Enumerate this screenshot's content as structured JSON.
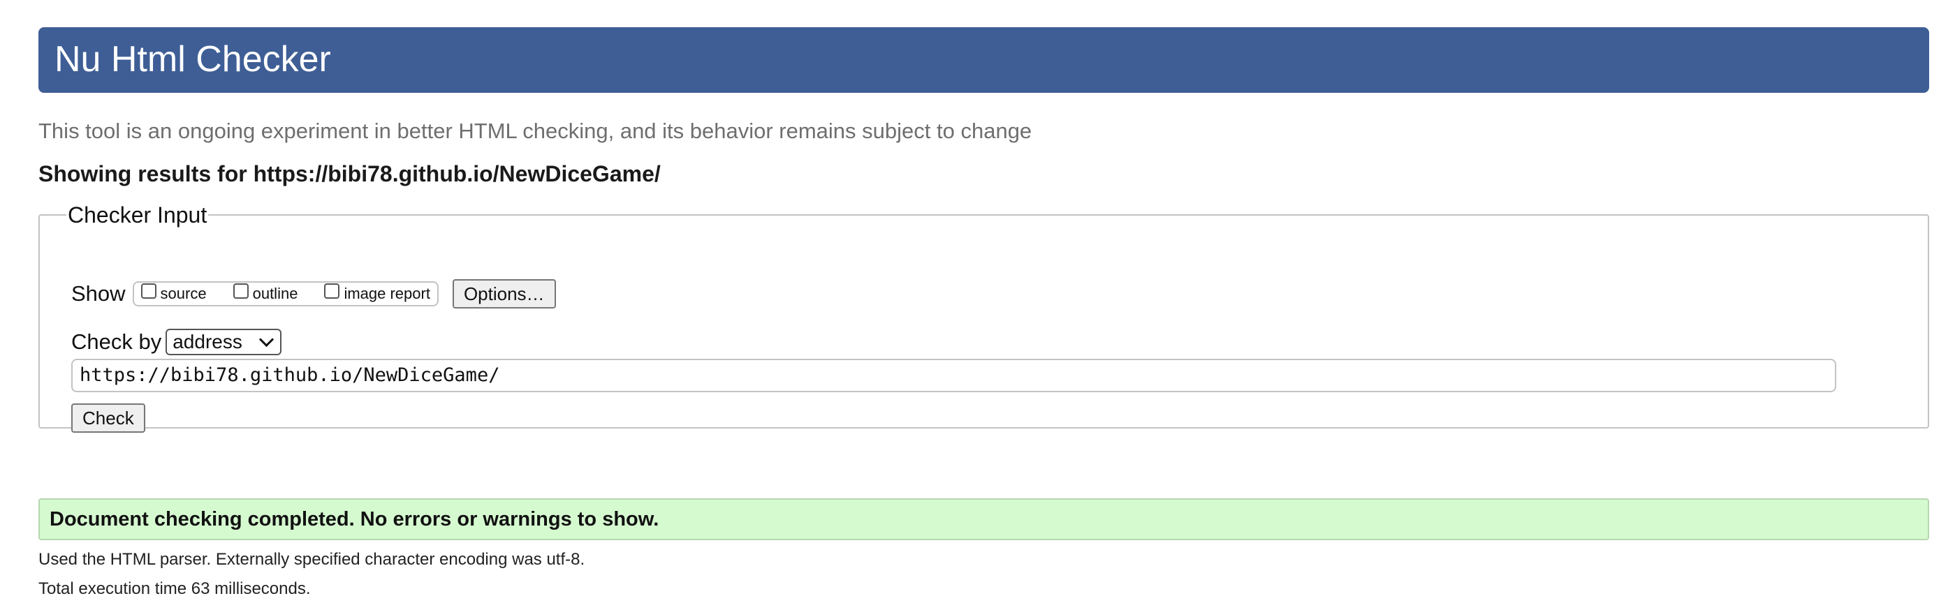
{
  "header": {
    "title": "Nu Html Checker"
  },
  "tagline": "This tool is an ongoing experiment in better HTML checking, and its behavior remains subject to change",
  "results_for": "Showing results for https://bibi78.github.io/NewDiceGame/",
  "checker_input": {
    "legend": "Checker Input",
    "show_label": "Show",
    "show_options": [
      {
        "label": "source",
        "checked": false
      },
      {
        "label": "outline",
        "checked": false
      },
      {
        "label": "image report",
        "checked": false
      }
    ],
    "options_button": "Options…",
    "check_by_label": "Check by",
    "check_by_value": "address",
    "url_value": "https://bibi78.github.io/NewDiceGame/",
    "check_button": "Check"
  },
  "result": {
    "message": "Document checking completed. No errors or warnings to show.",
    "parser_info": "Used the HTML parser. Externally specified character encoding was utf-8.",
    "execution_time": "Total execution time 63 milliseconds."
  },
  "colors": {
    "header_bg": "#3e5e95",
    "success_bg": "#d6fad0"
  }
}
